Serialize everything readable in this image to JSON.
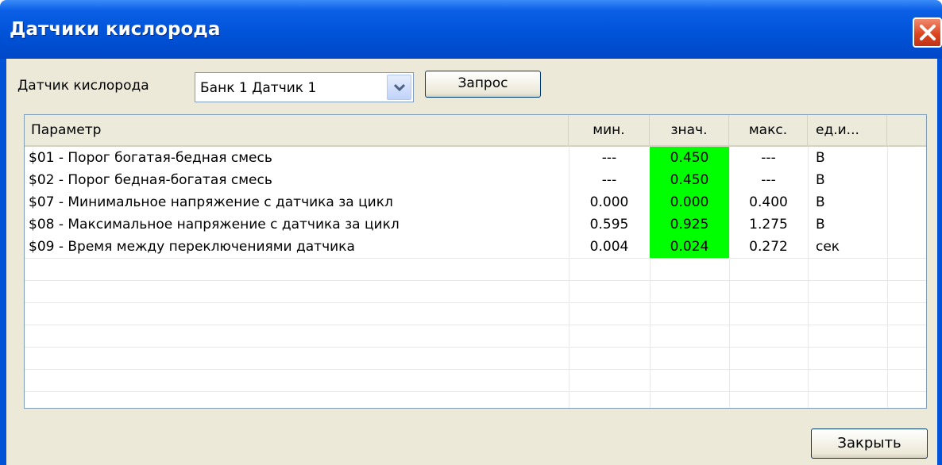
{
  "window": {
    "title": "Датчики кислорода"
  },
  "toolbar": {
    "sensor_label": "Датчик кислорода",
    "sensor_select": "Банк 1 Датчик 1",
    "query_label": "Запрос"
  },
  "table": {
    "columns": [
      "Параметр",
      "мин.",
      "знач.",
      "макс.",
      "ед.и..."
    ],
    "rows": [
      {
        "param": "$01 - Порог богатая-бедная смесь",
        "min": "---",
        "value": "0.450",
        "max": "---",
        "unit": "В"
      },
      {
        "param": "$02 - Порог бедная-богатая смесь",
        "min": "---",
        "value": "0.450",
        "max": "---",
        "unit": "В"
      },
      {
        "param": "$07 - Минимальное напряжение с датчика за цикл",
        "min": "0.000",
        "value": "0.000",
        "max": "0.400",
        "unit": "В"
      },
      {
        "param": "$08 - Максимальное напряжение с датчика за цикл",
        "min": "0.595",
        "value": "0.925",
        "max": "1.275",
        "unit": "В"
      },
      {
        "param": "$09 - Время между переключениями датчика",
        "min": "0.004",
        "value": "0.024",
        "max": "0.272",
        "unit": "сек"
      }
    ]
  },
  "footer": {
    "close_label": "Закрыть"
  },
  "colors": {
    "highlight": "#00ff00",
    "title_bar": "#0052d6"
  },
  "icons": [
    "close-icon",
    "chevron-down-icon"
  ]
}
